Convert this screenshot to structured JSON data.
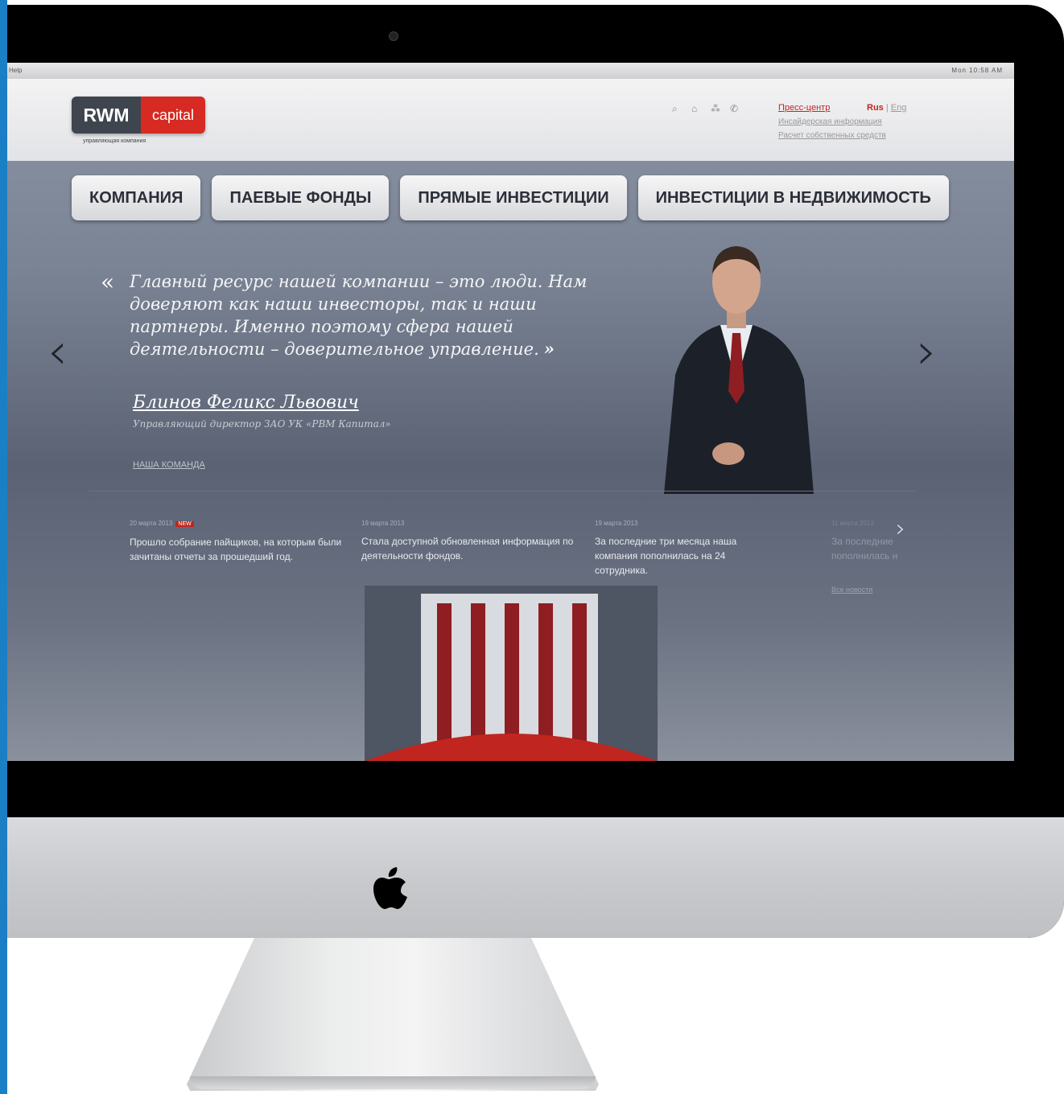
{
  "menubar": {
    "left": "Help",
    "right": "Mon 10:58 AM"
  },
  "brand": {
    "part1": "RWM",
    "part2": "capital",
    "tagline": "управляющая компания"
  },
  "header_links": {
    "press": "Пресс-центр",
    "rus": "Rus",
    "separator": "|",
    "eng": "Eng",
    "insider": "Инсайдерская информация",
    "calc": "Расчет собственных средств"
  },
  "nav": [
    {
      "label": "КОМПАНИЯ"
    },
    {
      "label": "ПАЕВЫЕ ФОНДЫ"
    },
    {
      "label": "ПРЯМЫЕ ИНВЕСТИЦИИ"
    },
    {
      "label": "ИНВЕСТИЦИИ В НЕДВИЖИМОСТЬ"
    }
  ],
  "slider": {
    "open_mark": "«",
    "close_mark": "»",
    "quote": "Главный ресурс нашей компании – это люди. Нам доверяют как наши инвесторы, так и наши партнеры. Именно поэтому сфера нашей деятельности – доверительное управление.",
    "author": "Блинов Феликс Львович",
    "author_title": "Управляющий директор ЗАО УК «РВМ Капитал»",
    "team_link": "НАША КОМАНДА",
    "prev": "‹",
    "next": "›"
  },
  "news": [
    {
      "date": "20 марта 2013",
      "badge": "NEW",
      "text": "Прошло собрание пайщиков, на которым были зачитаны отчеты за прошедший год."
    },
    {
      "date": "19 марта 2013",
      "text": "Стала доступной обновленная информация по деятельности фондов."
    },
    {
      "date": "19 марта 2013",
      "text": "За последние три месяца наша компания пополнилась на 24 сотрудника."
    },
    {
      "date": "11 марта 2013",
      "text": "За последние пополнилась н"
    }
  ],
  "news_next": "›",
  "all_news": "Все новости",
  "colors": {
    "accent": "#d62a22",
    "dark": "#3f454e"
  }
}
